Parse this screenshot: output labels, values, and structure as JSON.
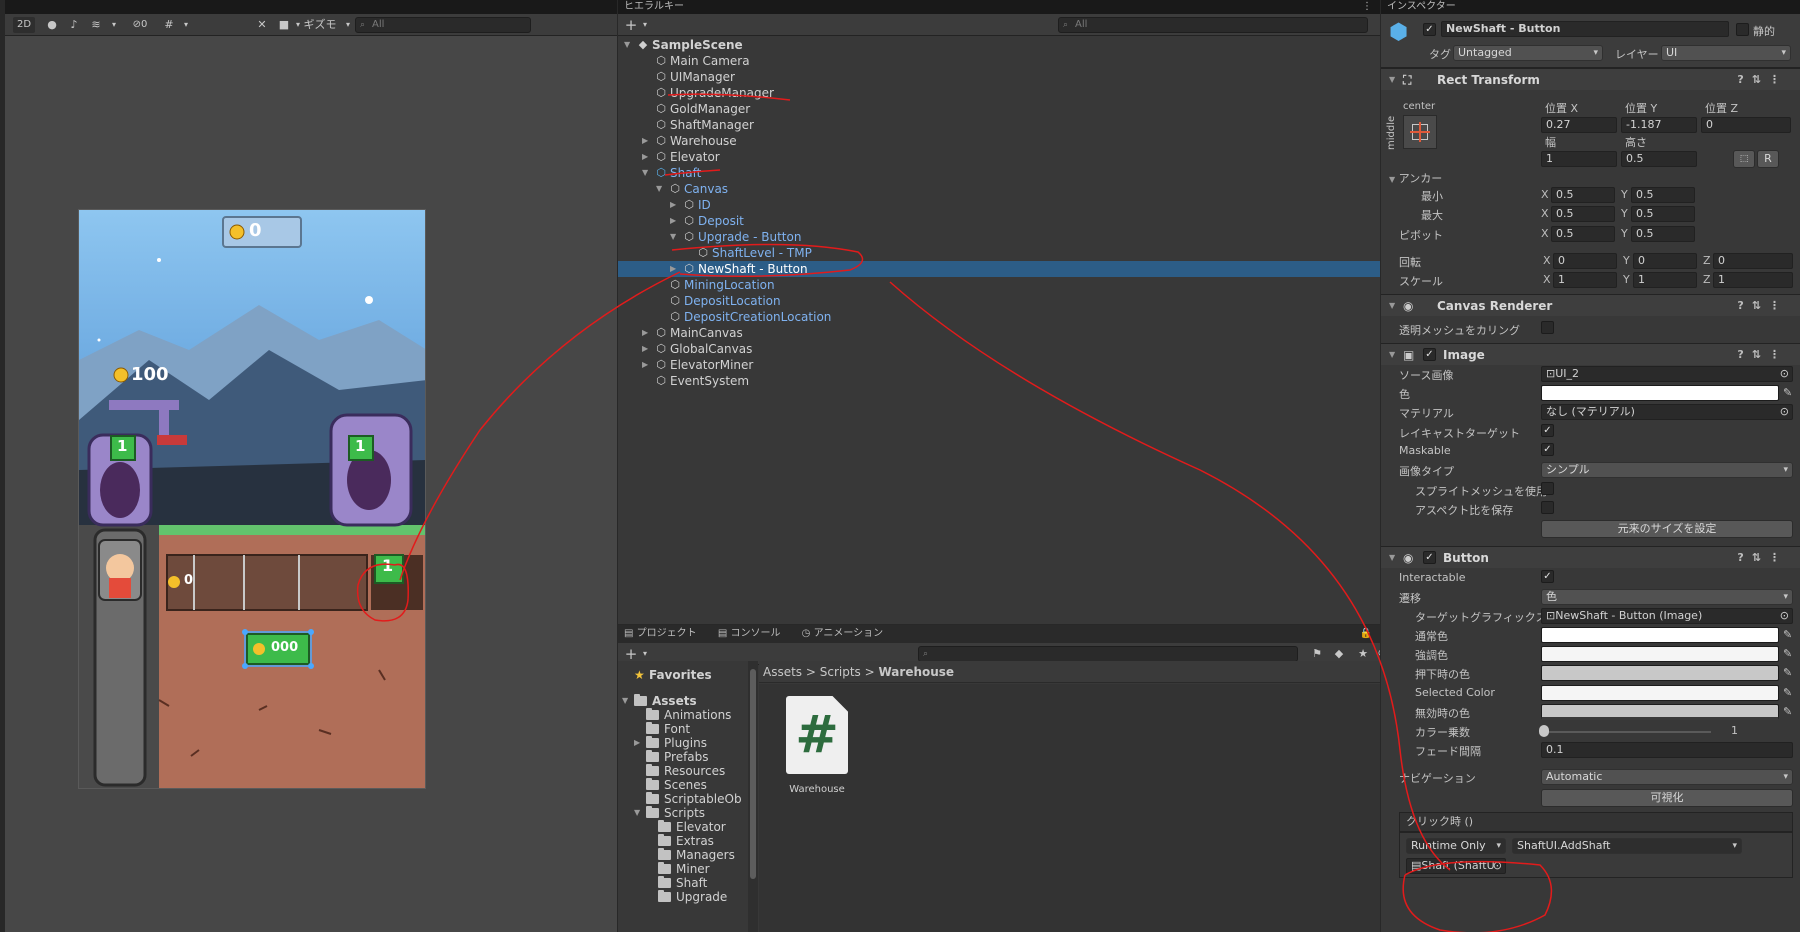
{
  "scene": {
    "toolbar": {
      "mode_2d": "2D",
      "hidden_count": "0",
      "gizmos": "ギズモ",
      "search_placeholder": "All"
    },
    "game": {
      "top_coins": "0",
      "shaft_level_left": "1",
      "shaft_level_right": "1",
      "warehouse_coins": "100",
      "shaft_coins": "0",
      "new_shaft_level": "1",
      "button_coins": "000"
    }
  },
  "hierarchy": {
    "tab": "ヒエラルキー",
    "search_placeholder": "All",
    "rows": [
      {
        "label": "SampleScene",
        "indent": 0,
        "arrow": "▼",
        "kind": "scene"
      },
      {
        "label": "Main Camera",
        "indent": 1,
        "arrow": ""
      },
      {
        "label": "UIManager",
        "indent": 1,
        "arrow": ""
      },
      {
        "label": "UpgradeManager",
        "indent": 1,
        "arrow": ""
      },
      {
        "label": "GoldManager",
        "indent": 1,
        "arrow": ""
      },
      {
        "label": "ShaftManager",
        "indent": 1,
        "arrow": ""
      },
      {
        "label": "Warehouse",
        "indent": 1,
        "arrow": "▶"
      },
      {
        "label": "Elevator",
        "indent": 1,
        "arrow": "▶"
      },
      {
        "label": "Shaft",
        "indent": 1,
        "arrow": "▼",
        "blue": true
      },
      {
        "label": "Canvas",
        "indent": 2,
        "arrow": "▼",
        "blue": true
      },
      {
        "label": "ID",
        "indent": 3,
        "arrow": "▶",
        "blue": true
      },
      {
        "label": "Deposit",
        "indent": 3,
        "arrow": "▶",
        "blue": true
      },
      {
        "label": "Upgrade - Button",
        "indent": 3,
        "arrow": "▼",
        "blue": true
      },
      {
        "label": "ShaftLevel - TMP",
        "indent": 4,
        "arrow": "",
        "blue": true
      },
      {
        "label": "NewShaft - Button",
        "indent": 3,
        "arrow": "▶",
        "blue": true,
        "selected": true
      },
      {
        "label": "MiningLocation",
        "indent": 2,
        "arrow": "",
        "blue": true
      },
      {
        "label": "DepositLocation",
        "indent": 2,
        "arrow": "",
        "blue": true
      },
      {
        "label": "DepositCreationLocation",
        "indent": 2,
        "arrow": "",
        "blue": true
      },
      {
        "label": "MainCanvas",
        "indent": 1,
        "arrow": "▶"
      },
      {
        "label": "GlobalCanvas",
        "indent": 1,
        "arrow": "▶"
      },
      {
        "label": "ElevatorMiner",
        "indent": 1,
        "arrow": "▶"
      },
      {
        "label": "EventSystem",
        "indent": 1,
        "arrow": ""
      }
    ]
  },
  "project": {
    "tabs": [
      "プロジェクト",
      "コンソール",
      "アニメーション"
    ],
    "hidden_count": "8",
    "favorites": "Favorites",
    "tree": [
      {
        "label": "Assets",
        "indent": 0,
        "arrow": "▼",
        "bold": true
      },
      {
        "label": "Animations",
        "indent": 1,
        "arrow": ""
      },
      {
        "label": "Font",
        "indent": 1,
        "arrow": ""
      },
      {
        "label": "Plugins",
        "indent": 1,
        "arrow": "▶"
      },
      {
        "label": "Prefabs",
        "indent": 1,
        "arrow": ""
      },
      {
        "label": "Resources",
        "indent": 1,
        "arrow": ""
      },
      {
        "label": "Scenes",
        "indent": 1,
        "arrow": ""
      },
      {
        "label": "ScriptableOb",
        "indent": 1,
        "arrow": ""
      },
      {
        "label": "Scripts",
        "indent": 1,
        "arrow": "▼"
      },
      {
        "label": "Elevator",
        "indent": 2,
        "arrow": ""
      },
      {
        "label": "Extras",
        "indent": 2,
        "arrow": ""
      },
      {
        "label": "Managers",
        "indent": 2,
        "arrow": ""
      },
      {
        "label": "Miner",
        "indent": 2,
        "arrow": ""
      },
      {
        "label": "Shaft",
        "indent": 2,
        "arrow": ""
      },
      {
        "label": "Upgrade",
        "indent": 2,
        "arrow": ""
      }
    ],
    "breadcrumb": [
      "Assets",
      "Scripts",
      "Warehouse"
    ],
    "asset": {
      "name": "Warehouse",
      "glyph": "#"
    }
  },
  "inspector": {
    "tab": "インスペクター",
    "object_name": "NewShaft - Button",
    "static_label": "静的",
    "tag_label": "タグ",
    "tag_value": "Untagged",
    "layer_label": "レイヤー",
    "layer_value": "UI",
    "rect": {
      "title": "Rect Transform",
      "anchor_h": "center",
      "anchor_v": "middle",
      "pos_x_label": "位置 X",
      "pos_y_label": "位置 Y",
      "pos_z_label": "位置 Z",
      "pos_x": "0.27",
      "pos_y": "-1.187",
      "pos_z": "0",
      "width_label": "幅",
      "height_label": "高さ",
      "width": "1",
      "height": "0.5",
      "r_button": "R",
      "anchors_label": "アンカー",
      "min_label": "最小",
      "max_label": "最大",
      "min_x": "0.5",
      "min_y": "0.5",
      "max_x": "0.5",
      "max_y": "0.5",
      "pivot_label": "ピボット",
      "pivot_x": "0.5",
      "pivot_y": "0.5",
      "rotation_label": "回転",
      "rot_x": "0",
      "rot_y": "0",
      "rot_z": "0",
      "scale_label": "スケール",
      "scale_x": "1",
      "scale_y": "1",
      "scale_z": "1"
    },
    "canvas_renderer": {
      "title": "Canvas Renderer",
      "cull_label": "透明メッシュをカリング"
    },
    "image": {
      "title": "Image",
      "source_label": "ソース画像",
      "source_value": "UI_2",
      "color_label": "色",
      "material_label": "マテリアル",
      "material_value": "なし (マテリアル)",
      "raycast_label": "レイキャストターゲット",
      "maskable_label": "Maskable",
      "type_label": "画像タイプ",
      "type_value": "シンプル",
      "sprite_mesh_label": "スプライトメッシュを使用",
      "preserve_label": "アスペクト比を保存",
      "native_size_button": "元来のサイズを設定"
    },
    "button": {
      "title": "Button",
      "interactable_label": "Interactable",
      "transition_label": "遷移",
      "transition_value": "色",
      "target_label": "ターゲットグラフィックス",
      "target_value": "NewShaft - Button (Image)",
      "normal_label": "通常色",
      "highlight_label": "強調色",
      "pressed_label": "押下時の色",
      "selected_label": "Selected Color",
      "disabled_label": "無効時の色",
      "multiplier_label": "カラー乗数",
      "multiplier_value": "1",
      "fade_label": "フェード間隔",
      "fade_value": "0.1",
      "nav_label": "ナビゲーション",
      "nav_value": "Automatic",
      "visualize_button": "可視化",
      "onclick_label": "クリック時 ()",
      "runtime_value": "Runtime Only",
      "function_value": "ShaftUI.AddShaft",
      "object_value": "Shaft (ShaftU"
    }
  }
}
